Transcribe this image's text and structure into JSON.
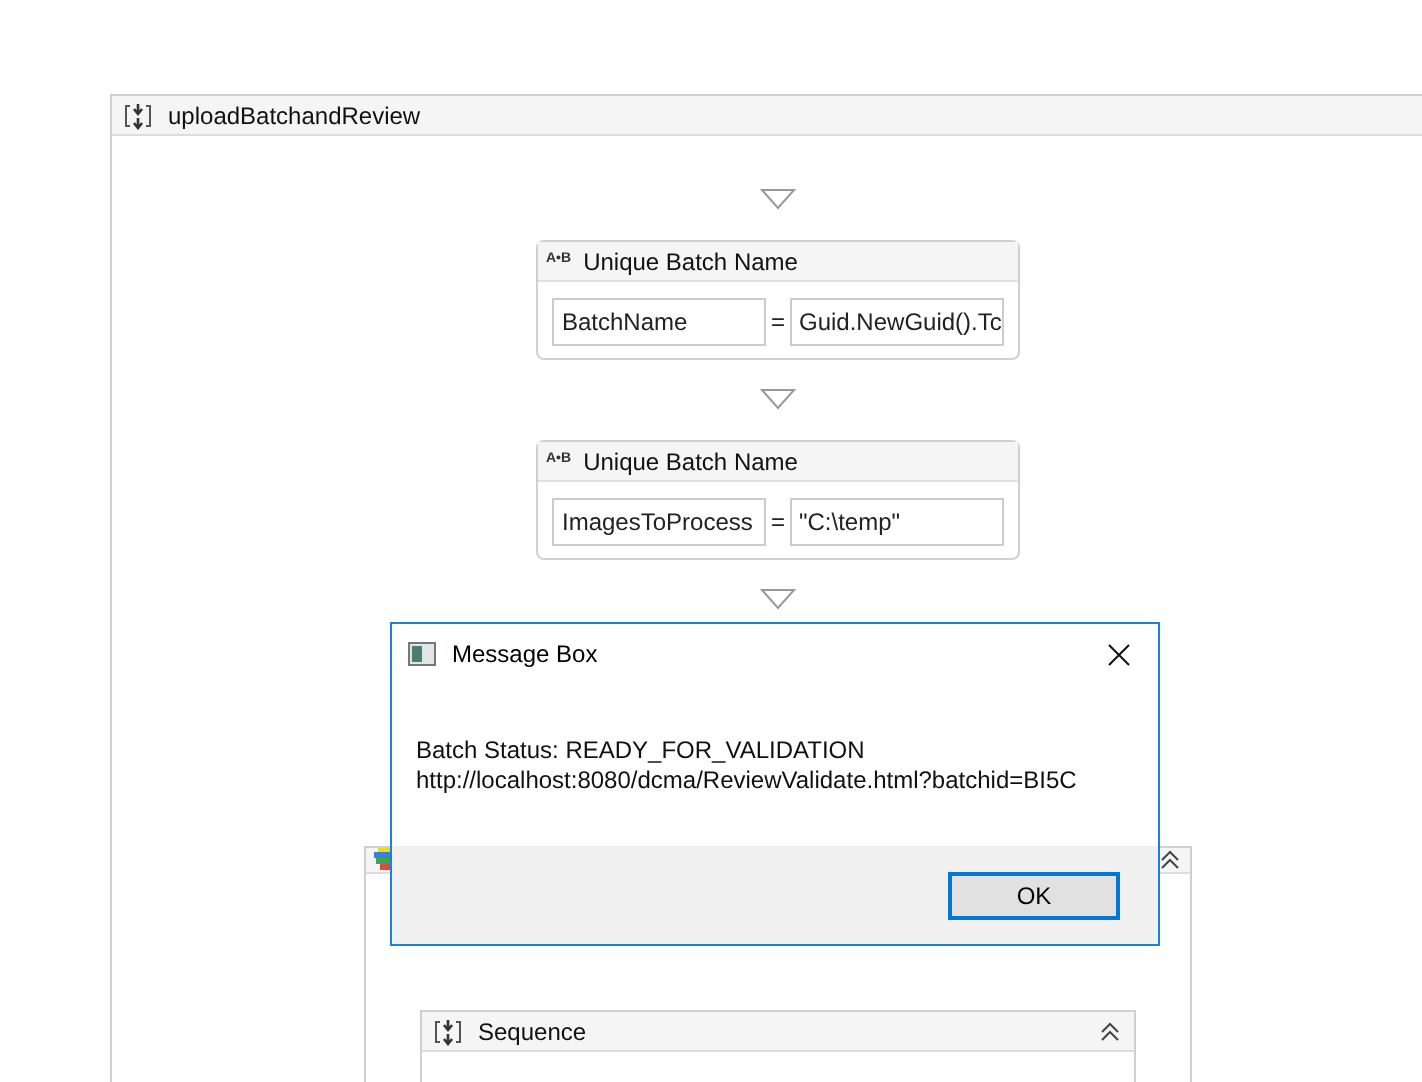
{
  "workflow": {
    "title": "uploadBatchandReview"
  },
  "activities": [
    {
      "kind": "assign",
      "icon": "A•B",
      "title": "Unique Batch Name",
      "to": "BatchName",
      "operator": "=",
      "value": "Guid.NewGuid().Tc"
    },
    {
      "kind": "assign",
      "icon": "A•B",
      "title": "Unique Batch Name",
      "to": "ImagesToProcess",
      "operator": "=",
      "value": "\"C:\\temp\""
    }
  ],
  "flowchart": {
    "sequence": {
      "title": "Sequence"
    }
  },
  "dialog": {
    "title": "Message Box",
    "lines": [
      "Batch Status: READY_FOR_VALIDATION",
      "http://localhost:8080/dcma/ReviewValidate.html?batchid=BI5C"
    ],
    "buttons": [
      "OK"
    ]
  }
}
